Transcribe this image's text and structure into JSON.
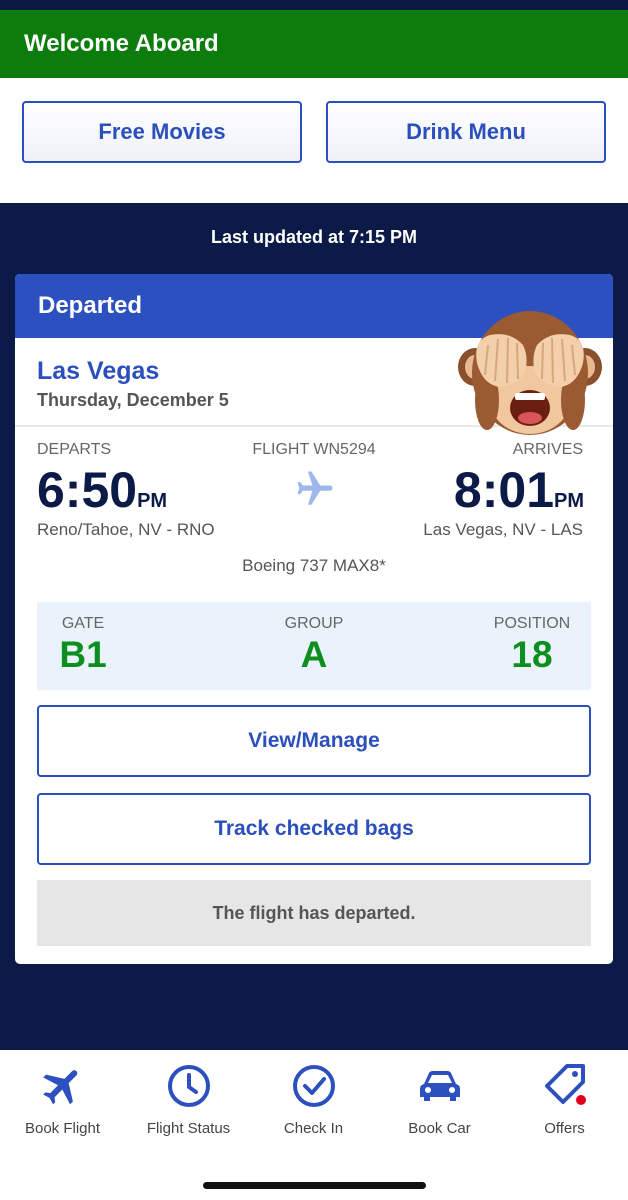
{
  "header": {
    "welcome": "Welcome Aboard"
  },
  "promos": {
    "movies": "Free Movies",
    "drinks": "Drink Menu"
  },
  "last_updated": "Last updated at 7:15 PM",
  "flight_card": {
    "status": "Departed",
    "destination": "Las Vegas",
    "date": "Thursday, December 5",
    "departs_label": "DEPARTS",
    "flight_label": "FLIGHT WN5294",
    "arrives_label": "ARRIVES",
    "depart_time": "6:50",
    "depart_ampm": "PM",
    "arrive_time": "8:01",
    "arrive_ampm": "PM",
    "depart_city": "Reno/Tahoe, NV - RNO",
    "arrive_city": "Las Vegas, NV - LAS",
    "aircraft": "Boeing 737 MAX8*",
    "gate_label": "GATE",
    "gate": "B1",
    "group_label": "GROUP",
    "group": "A",
    "position_label": "POSITION",
    "position": "18",
    "view_manage": "View/Manage",
    "track_bags": "Track checked bags",
    "departed_note": "The flight has departed."
  },
  "tabs": [
    {
      "label": "Book Flight",
      "icon": "airplane-icon"
    },
    {
      "label": "Flight Status",
      "icon": "clock-icon"
    },
    {
      "label": "Check In",
      "icon": "checkmark-circle-icon"
    },
    {
      "label": "Book Car",
      "icon": "car-icon"
    },
    {
      "label": "Offers",
      "icon": "tag-icon"
    }
  ],
  "colors": {
    "navy": "#0c1a47",
    "brand_blue": "#2d50c0",
    "welcome_green": "#0c7d0c",
    "boarding_green": "#0c8f1e",
    "notification_red": "#e0001b"
  }
}
